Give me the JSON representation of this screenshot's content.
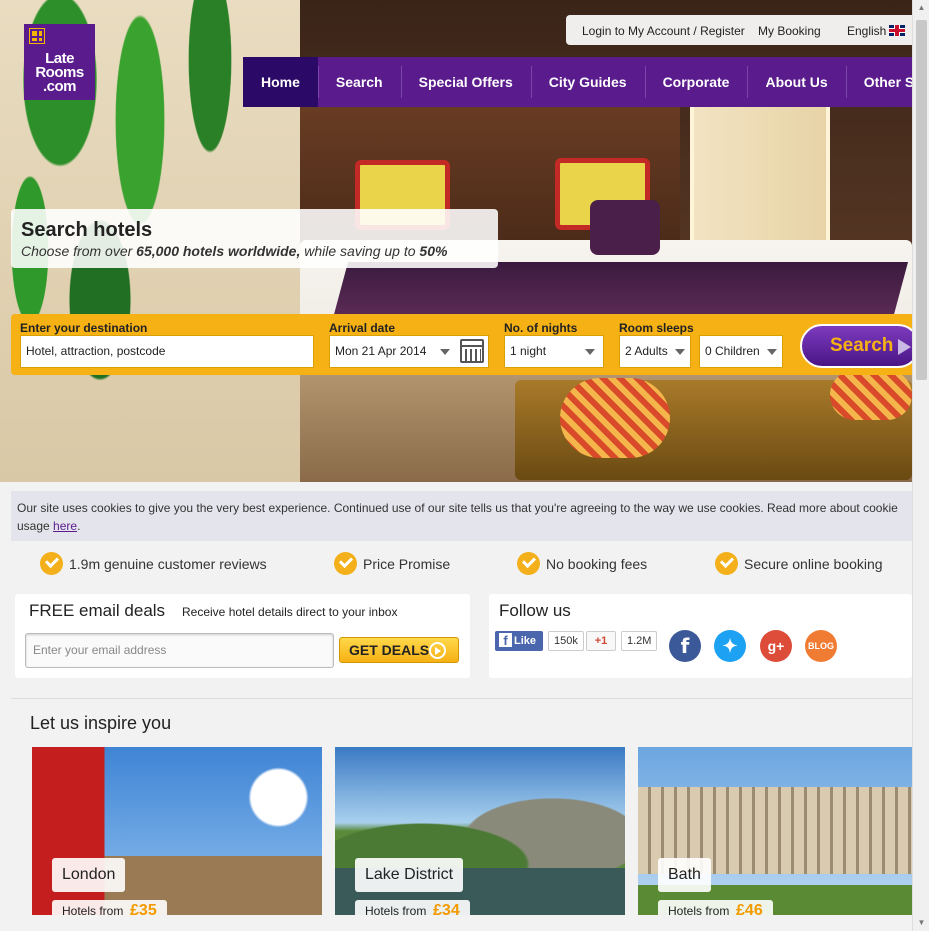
{
  "logo": {
    "line1": "Late",
    "line2": "Rooms",
    "line3": ".com"
  },
  "topbar": {
    "login": "Login to My Account / Register",
    "booking": "My Booking",
    "language": "English"
  },
  "nav": [
    "Home",
    "Search",
    "Special Offers",
    "City Guides",
    "Corporate",
    "About Us",
    "Other Services"
  ],
  "hero": {
    "title": "Search hotels",
    "subtitle_pre": "Choose from over ",
    "subtitle_bold1": "65,000 hotels worldwide,",
    "subtitle_mid": " while saving up to ",
    "subtitle_bold2": "50%"
  },
  "form": {
    "destination_label": "Enter your destination",
    "destination_value": "Hotel, attraction, postcode",
    "arrival_label": "Arrival date",
    "arrival_value": "Mon 21 Apr 2014",
    "nights_label": "No. of nights",
    "nights_value": "1 night",
    "sleeps_label": "Room sleeps",
    "adults_value": "2 Adults",
    "children_value": "0 Children",
    "search_button": "Search"
  },
  "cookie": {
    "text": "Our site uses cookies to give you the very best experience. Continued use of our site tells us that you're agreeing to the way we use cookies. Read more about cookie usage ",
    "link": "here",
    "end": "."
  },
  "usps": [
    "1.9m genuine customer reviews",
    "Price Promise",
    "No booking fees",
    "Secure online booking"
  ],
  "email": {
    "title": "FREE email deals",
    "subtitle": "Receive hotel details direct to your inbox",
    "placeholder": "Enter your email address",
    "button": "GET DEALS"
  },
  "follow": {
    "title": "Follow us",
    "fb_like": "Like",
    "fb_count": "150k",
    "gplus": "+1",
    "gplus_count": "1.2M",
    "icons": [
      "facebook-icon",
      "twitter-icon",
      "google-plus-icon",
      "blog-icon"
    ],
    "blog_label": "BLOG",
    "gplus_icon_label": "g+"
  },
  "inspire": {
    "title": "Let us inspire you",
    "cards": [
      {
        "city": "London",
        "price_label": "Hotels from",
        "price": "£35"
      },
      {
        "city": "Lake District",
        "price_label": "Hotels from",
        "price": "£34"
      },
      {
        "city": "Bath",
        "price_label": "Hotels from",
        "price": "£46"
      }
    ]
  },
  "colors": {
    "brand_purple": "#5a1b8d",
    "nav_active": "#2a0a66",
    "accent_yellow": "#f6b114",
    "price_orange": "#f39a00"
  }
}
